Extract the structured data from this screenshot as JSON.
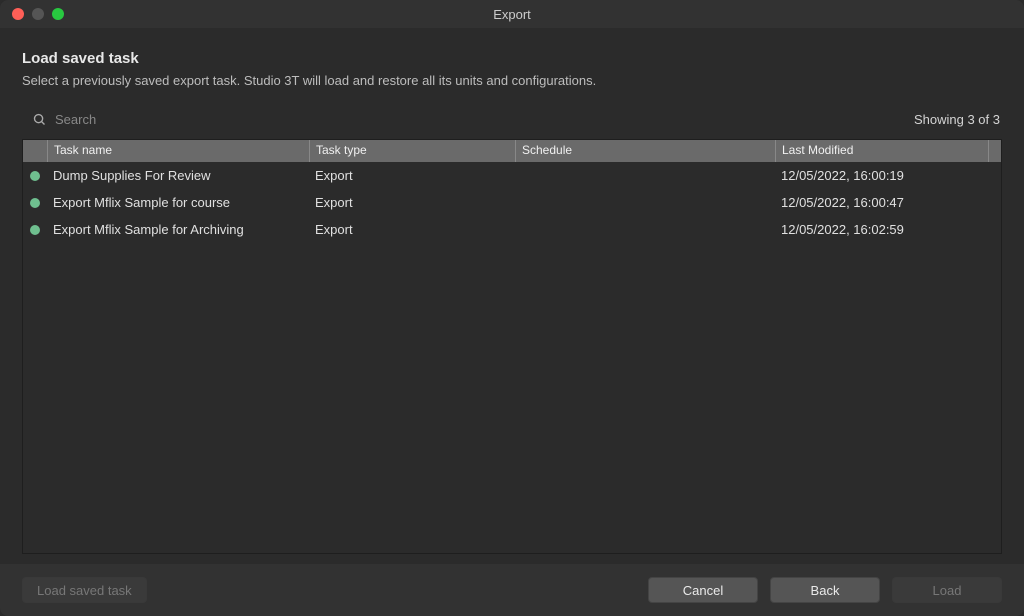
{
  "window": {
    "title": "Export"
  },
  "header": {
    "title": "Load saved task",
    "description": "Select a previously saved export task. Studio 3T will load and restore all its units and configurations."
  },
  "search": {
    "placeholder": "Search",
    "value": ""
  },
  "results": {
    "label": "Showing 3 of 3"
  },
  "table": {
    "columns": {
      "name": "Task name",
      "type": "Task type",
      "schedule": "Schedule",
      "modified": "Last Modified"
    },
    "rows": [
      {
        "status": "ok",
        "name": "Dump Supplies For Review",
        "type": "Export",
        "schedule": "",
        "modified": "12/05/2022, 16:00:19"
      },
      {
        "status": "ok",
        "name": "Export Mflix Sample for course",
        "type": "Export",
        "schedule": "",
        "modified": "12/05/2022, 16:00:47"
      },
      {
        "status": "ok",
        "name": "Export Mflix Sample for Archiving",
        "type": "Export",
        "schedule": "",
        "modified": "12/05/2022, 16:02:59"
      }
    ]
  },
  "footer": {
    "load_saved_task": "Load saved task",
    "cancel": "Cancel",
    "back": "Back",
    "load": "Load"
  },
  "colors": {
    "status_ok": "#6fbf8f"
  }
}
